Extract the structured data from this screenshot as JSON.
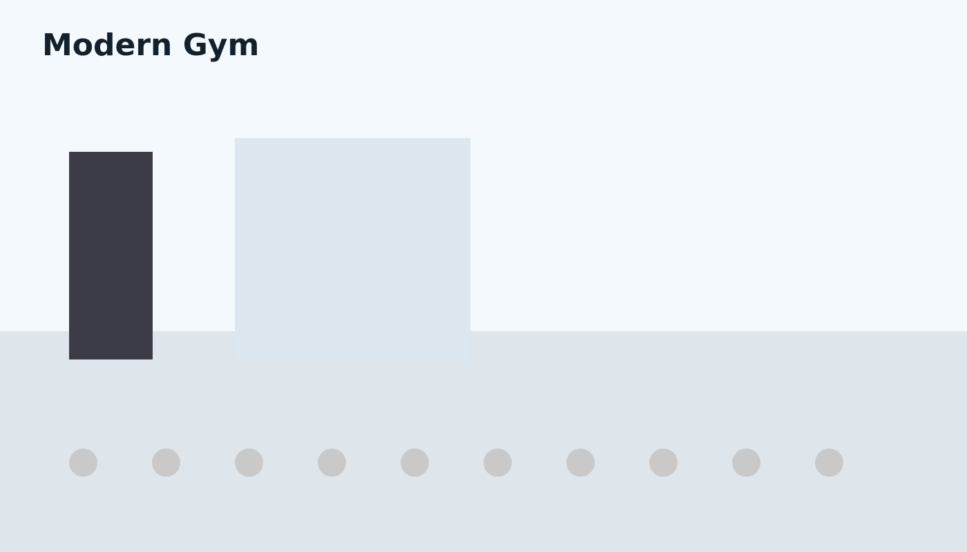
{
  "page": {
    "title": "Modern Gym"
  },
  "colors": {
    "wall": "#f3f9fc",
    "floor": "#dfe6eb",
    "title": "#15202d",
    "dark_panel": "#3c3c46",
    "light_panel": "#dde7ef",
    "dots": "#c9c9c9"
  }
}
